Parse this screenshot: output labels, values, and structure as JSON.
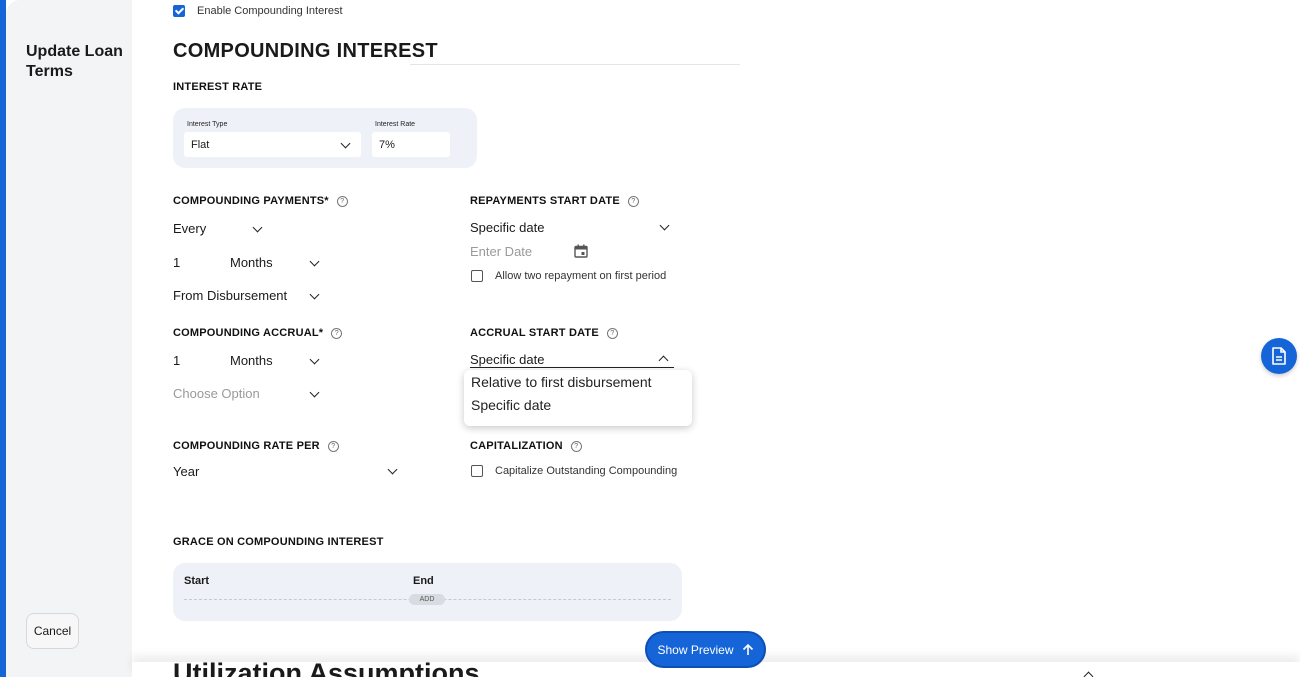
{
  "sidebar": {
    "title": "Update Loan Terms",
    "cancel_label": "Cancel"
  },
  "enable_compounding": {
    "label": "Enable Compounding Interest",
    "checked": true
  },
  "section_title": "COMPOUNDING INTEREST",
  "interest_rate": {
    "label": "INTEREST RATE",
    "type_label": "Interest Type",
    "type_value": "Flat",
    "rate_label": "Interest Rate",
    "rate_value": "7%"
  },
  "compounding_payments": {
    "label": "COMPOUNDING PAYMENTS*",
    "frequency": "Every",
    "count": "1",
    "unit": "Months",
    "from": "From Disbursement"
  },
  "repayments_start": {
    "label": "REPAYMENTS START DATE",
    "mode": "Specific date",
    "date_placeholder": "Enter Date",
    "allow_two_label": "Allow two repayment on first period",
    "allow_two_checked": false
  },
  "compounding_accrual": {
    "label": "COMPOUNDING ACCRUAL*",
    "count": "1",
    "unit": "Months",
    "option_placeholder": "Choose Option"
  },
  "accrual_start": {
    "label": "ACCRUAL START DATE",
    "mode": "Specific date",
    "options": [
      "Relative to first disbursement",
      "Specific date"
    ]
  },
  "compounding_rate_per": {
    "label": "COMPOUNDING RATE PER",
    "value": "Year"
  },
  "capitalization": {
    "label": "CAPITALIZATION",
    "option_label": "Capitalize Outstanding Compounding",
    "checked": false
  },
  "grace": {
    "label": "GRACE ON COMPOUNDING INTEREST",
    "start_label": "Start",
    "end_label": "End",
    "add_label": "ADD"
  },
  "next_section_title": "Utilization Assumptions",
  "preview_button": "Show Preview",
  "colors": {
    "accent": "#1565d8",
    "panel": "#eef2f8",
    "sidebar": "#f3f4f6"
  },
  "icons": [
    "help-icon",
    "chevron-down-icon",
    "chevron-up-icon",
    "calendar-icon",
    "arrow-up-icon",
    "document-icon",
    "check-icon"
  ]
}
